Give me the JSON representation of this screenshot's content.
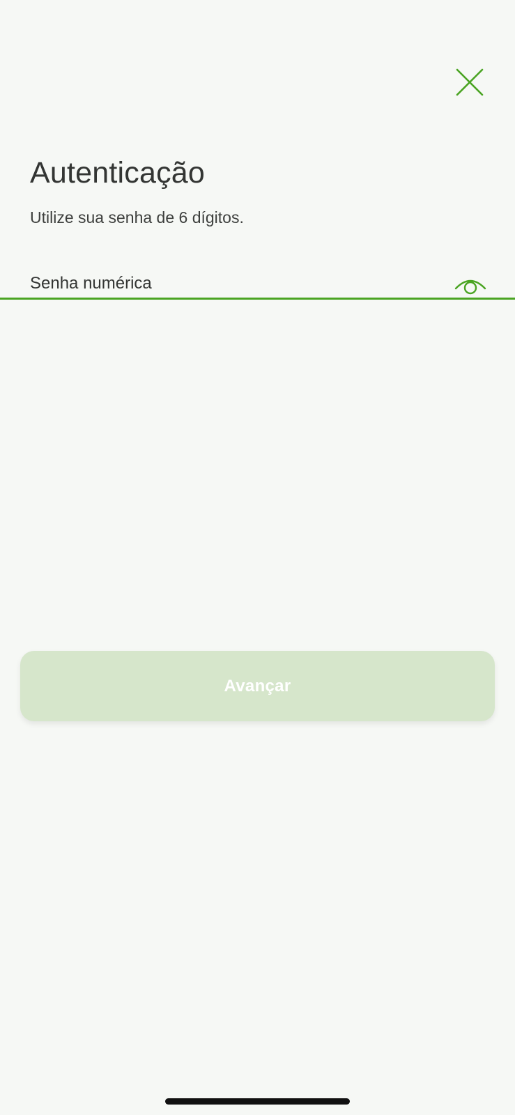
{
  "header": {
    "close_icon": "close-icon"
  },
  "auth": {
    "title": "Autenticação",
    "subtitle": "Utilize sua senha de 6 dígitos."
  },
  "password_field": {
    "label": "Senha numérica",
    "value": "",
    "toggle_icon": "eye-icon"
  },
  "actions": {
    "advance_label": "Avançar"
  },
  "colors": {
    "accent": "#4aa422",
    "button_disabled_bg": "#d6e6cb",
    "background": "#f6f8f5",
    "text": "#333533"
  }
}
